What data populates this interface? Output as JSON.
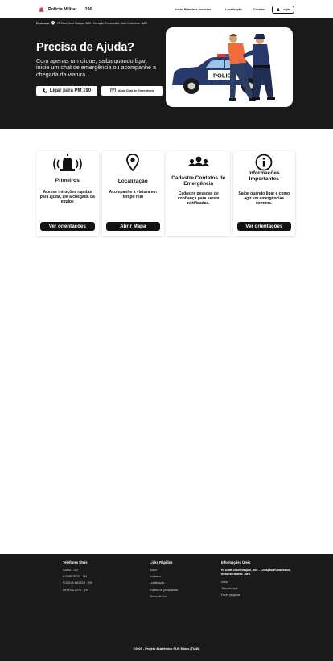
{
  "header": {
    "brand_name": "Polícia Militar",
    "brand_number": "190",
    "nav": [
      "Início",
      "Primeiros Socorros",
      "Localização",
      "Contatos"
    ],
    "login_label": "Login"
  },
  "hero": {
    "address_label": "Endereço",
    "address_value": "R. Dom José Gaspar, 500 - Coração Eucarístico, Belo Horizonte - MG",
    "title": "Precisa de Ajuda?",
    "subtitle": "Com apenas um clique, saiba quando ligar, inicie um chat de emergência ou acompanhe a chegada da viatura.",
    "call_button": "Ligar para PM  190",
    "chat_button": "Abrir Chat de Emergência",
    "car_text": "POLICE"
  },
  "cards": [
    {
      "title": "Primeiros",
      "description": "Acesse intruções rapidas para ajuda, ate a chegada da equipe",
      "button": "Ver orientações",
      "icon": "siren-icon"
    },
    {
      "title": "Localização",
      "description": "Acompanhe a viatura em tempo real",
      "button": "Abrir Mapa",
      "icon": "map-pin-icon"
    },
    {
      "title": "Cadastre Contatos de Emergência",
      "description": "Cadastre pessoas de confiança para serem notificadas.",
      "button": "",
      "icon": "people-icon"
    },
    {
      "title": "Informações Importantes",
      "description": "Saiba quando ligar e como agir em emergências comuns.",
      "button": "Ver orientações",
      "icon": "info-icon"
    }
  ],
  "footer": {
    "phones_title": "Telefones Úteis",
    "phones": [
      "SAMU - 192",
      "BOMBEIROS - 193",
      "POLÍCIA MILITAR - 190",
      "DEFESA CIVIL - 199"
    ],
    "links_title": "Links Rápidos",
    "links": [
      "Sobre",
      "Contatos",
      "Localização",
      "Política de privacidade",
      "Termo de Uso"
    ],
    "info_title": "Informações Úteis",
    "info_address": "R. Dom José Gaspar, 500 - Coração Eucarístico, Belo Horizonte - MG",
    "info_links": [
      "Início",
      "Tela principal",
      "Fazer pergunta"
    ],
    "copyright": "©2025 - Projeto Acadêmico PUC Minas (TIAW)"
  },
  "colors": {
    "dark": "#1a1a1a",
    "accent_red": "#e53935",
    "police_blue": "#283a6b",
    "shirt_orange": "#f26b3a"
  }
}
